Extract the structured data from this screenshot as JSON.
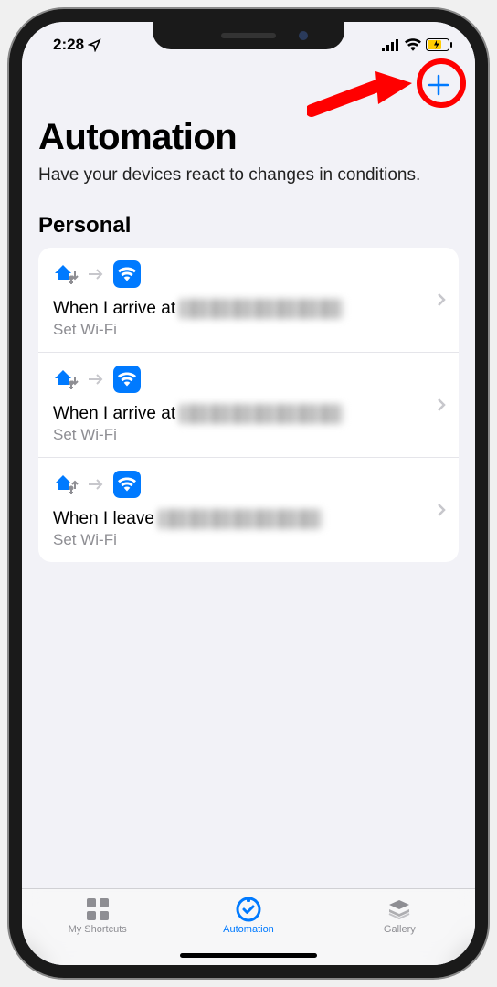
{
  "statusBar": {
    "time": "2:28"
  },
  "navBar": {
    "addLabel": "+"
  },
  "header": {
    "title": "Automation",
    "subtitle": "Have your devices react to changes in conditions."
  },
  "section": {
    "title": "Personal"
  },
  "automations": [
    {
      "titlePrefix": "When I arrive at",
      "action": "Set Wi-Fi"
    },
    {
      "titlePrefix": "When I arrive at",
      "action": "Set Wi-Fi"
    },
    {
      "titlePrefix": "When I leave",
      "action": "Set Wi-Fi"
    }
  ],
  "tabs": {
    "shortcuts": "My Shortcuts",
    "automation": "Automation",
    "gallery": "Gallery"
  }
}
